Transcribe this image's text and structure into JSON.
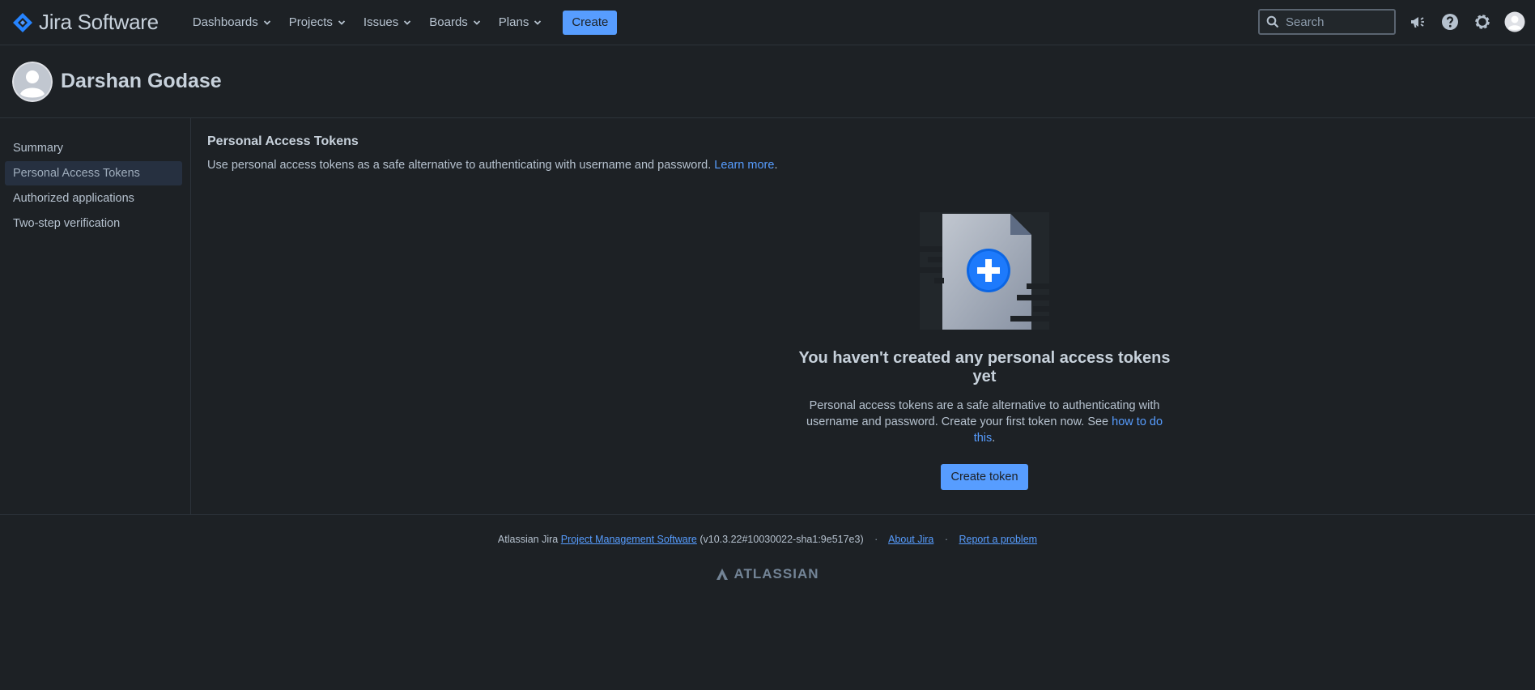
{
  "header": {
    "product": "Jira Software",
    "nav": [
      {
        "label": "Dashboards"
      },
      {
        "label": "Projects"
      },
      {
        "label": "Issues"
      },
      {
        "label": "Boards"
      },
      {
        "label": "Plans"
      }
    ],
    "create_label": "Create",
    "search_placeholder": "Search"
  },
  "profile": {
    "name": "Darshan Godase"
  },
  "sidebar": {
    "items": [
      {
        "label": "Summary"
      },
      {
        "label": "Personal Access Tokens"
      },
      {
        "label": "Authorized applications"
      },
      {
        "label": "Two-step verification"
      }
    ]
  },
  "main": {
    "title": "Personal Access Tokens",
    "description": "Use personal access tokens as a safe alternative to authenticating with username and password.",
    "learn_more": "Learn more",
    "period": "."
  },
  "empty_state": {
    "title": "You haven't created any personal access tokens yet",
    "desc_line1": "Personal access tokens are a safe alternative to authenticating with",
    "desc_line2": "username and password. Create your first token now. See",
    "how_link": "how to do this",
    "period": ".",
    "button": "Create token"
  },
  "footer": {
    "prefix": "Atlassian Jira",
    "pms_link": "Project Management Software",
    "version": "(v10.3.22#10030022-sha1:9e517e3)",
    "sep": "·",
    "about": "About Jira",
    "report": "Report a problem",
    "brand": "ATLASSIAN"
  },
  "colors": {
    "background": "#1d2125",
    "accent": "#579dff",
    "text": "#b6c2cf"
  }
}
